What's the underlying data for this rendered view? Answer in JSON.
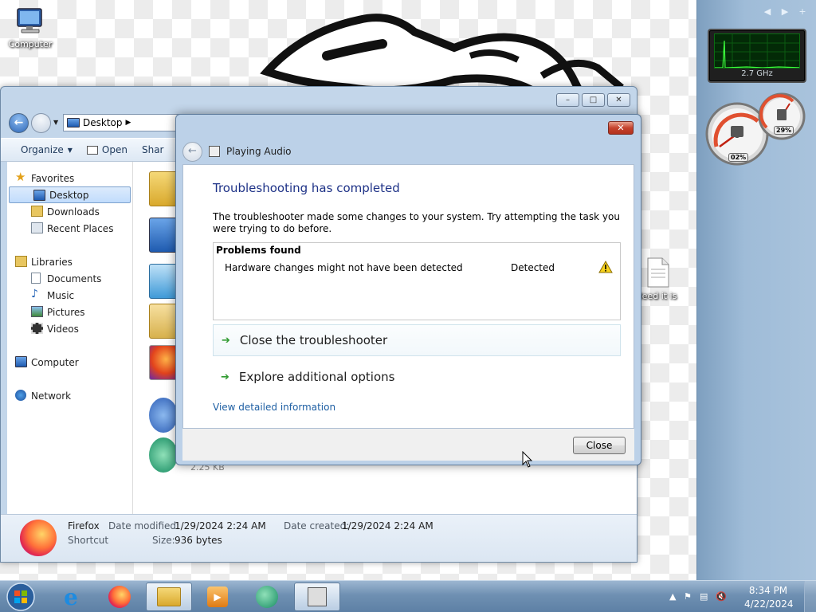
{
  "desktop": {
    "computer_label": "Computer",
    "doc_label": "leed it is"
  },
  "gadgets": {
    "cpu_freq": "2.7 GHz",
    "cpu_percent": "02%",
    "mem_percent": "29%"
  },
  "explorer": {
    "address": "Desktop",
    "toolbar": {
      "organize": "Organize",
      "open": "Open",
      "share": "Shar"
    },
    "nav": {
      "favorites": "Favorites",
      "desktop": "Desktop",
      "downloads": "Downloads",
      "recent": "Recent Places",
      "libraries": "Libraries",
      "documents": "Documents",
      "music": "Music",
      "pictures": "Pictures",
      "videos": "Videos",
      "computer": "Computer",
      "network": "Network"
    },
    "file_size_ghost": "2.25 KB",
    "details": {
      "name": "Firefox",
      "type": "Shortcut",
      "modified_label": "Date modified:",
      "modified": "1/29/2024 2:24 AM",
      "created_label": "Date created:",
      "created": "1/29/2024 2:24 AM",
      "size_label": "Size:",
      "size": "936 bytes"
    }
  },
  "dialog": {
    "header_title": "Playing Audio",
    "title": "Troubleshooting has completed",
    "message": "The troubleshooter made some changes to your system. Try attempting the task you were trying to do before.",
    "problems_heading": "Problems found",
    "problem_issue": "Hardware changes might not have been detected",
    "problem_status": "Detected",
    "close_troubleshooter": "Close the troubleshooter",
    "explore_options": "Explore additional options",
    "view_detailed": "View detailed information",
    "close_button": "Close"
  },
  "taskbar": {
    "time": "8:34 PM",
    "date": "4/22/2024"
  },
  "colors": {
    "title_blue": "#1e3287",
    "link_blue": "#1e5fa3",
    "green_arrow": "#2f9a2f",
    "taskbar": "#6f90b2"
  }
}
